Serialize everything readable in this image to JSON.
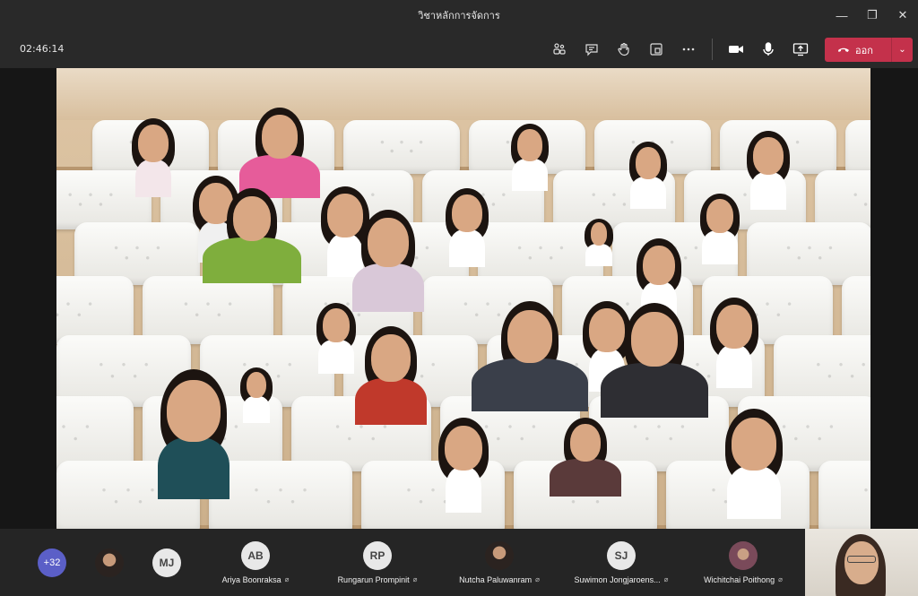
{
  "window": {
    "title": "วิชาหลักการจัดการ"
  },
  "toolbar": {
    "timer": "02:46:14",
    "leave_label": "ออก"
  },
  "participants": {
    "overflow_count": "+32",
    "extra_initials": "MJ",
    "people": [
      {
        "initials": "AB",
        "name": "Ariya Boonraksa"
      },
      {
        "initials": "RP",
        "name": "Rungarun Promp​init"
      },
      {
        "initials": "",
        "name": "Nutcha Paluwanram"
      },
      {
        "initials": "SJ",
        "name": "Suwimon Jongjaroens..."
      },
      {
        "initials": "",
        "name": "Wichitchai Poithong"
      }
    ]
  },
  "colors": {
    "leave": "#c4314b",
    "more_badge": "#5b5fc7"
  }
}
